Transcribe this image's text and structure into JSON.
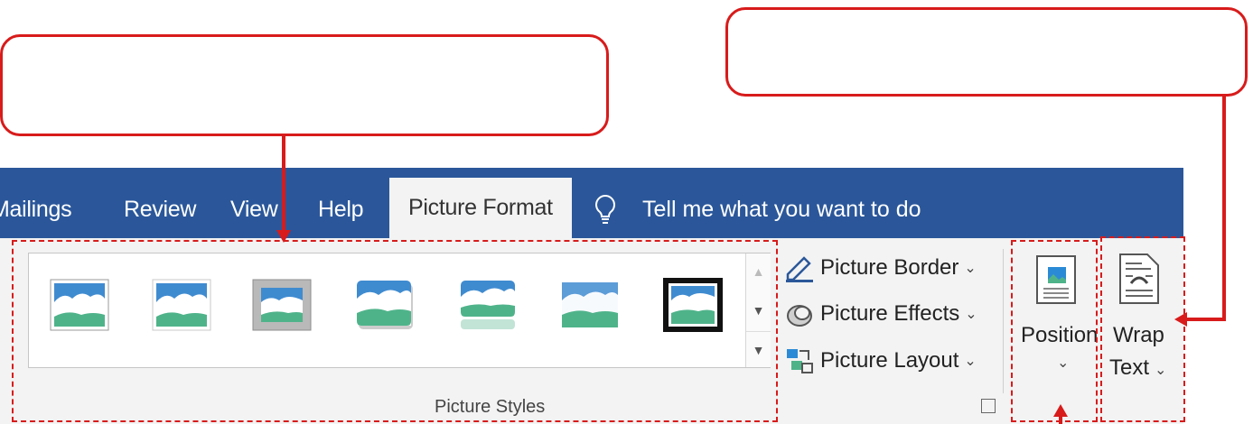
{
  "tabs": [
    {
      "label": "Mailings"
    },
    {
      "label": "Review"
    },
    {
      "label": "View"
    },
    {
      "label": "Help"
    },
    {
      "label": "Picture Format",
      "active": true
    }
  ],
  "tell_me": {
    "icon": "lightbulb-icon",
    "placeholder": "Tell me what you want to do"
  },
  "picture_styles": {
    "group_label": "Picture Styles",
    "thumbnails": [
      {
        "style": "simple-frame-white"
      },
      {
        "style": "soft-edge"
      },
      {
        "style": "simple-frame-gray"
      },
      {
        "style": "rounded-shadow"
      },
      {
        "style": "reflected-rounded"
      },
      {
        "style": "soft-edge-rectangle"
      },
      {
        "style": "thick-black-frame"
      }
    ],
    "scroll": {
      "up_icon": "scroll-up-icon",
      "down_icon": "scroll-down-icon",
      "more_icon": "gallery-more-icon"
    }
  },
  "commands": {
    "picture_border": "Picture Border",
    "picture_effects": "Picture Effects",
    "picture_layout": "Picture Layout"
  },
  "arrange": {
    "position": "Position",
    "wrap_text_line1": "Wrap",
    "wrap_text_line2": "Text"
  },
  "colors": {
    "ribbon": "#2b579a",
    "body": "#f3f3f3",
    "annotation": "#d81b1b"
  }
}
